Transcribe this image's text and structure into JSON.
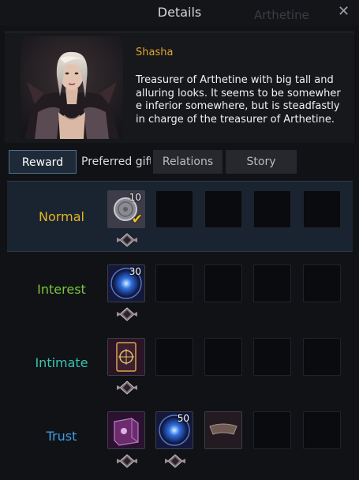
{
  "window": {
    "title": "Details",
    "ghost_title": "Arthetine",
    "close_label": "✕"
  },
  "npc": {
    "name": "Shasha",
    "description": "Treasurer of Arthetine with big tall and\nalluring looks. It seems to be somewher\ne inferior somewhere, but is steadfastly\nin charge of the treasurer of Arthetine."
  },
  "tabs": [
    {
      "label": "Reward",
      "active": true
    },
    {
      "label": "Preferred gift",
      "active": false
    },
    {
      "label": "Relations",
      "active": false
    },
    {
      "label": "Story",
      "active": false
    }
  ],
  "tiers": [
    {
      "label": "Normal",
      "color": "#e6b325",
      "rewards": [
        {
          "icon": "silver-coin-icon",
          "count": "10",
          "claimed": true
        }
      ]
    },
    {
      "label": "Interest",
      "color": "#78c83a",
      "rewards": [
        {
          "icon": "blue-orb-icon",
          "count": "30",
          "claimed": false
        }
      ]
    },
    {
      "label": "Intimate",
      "color": "#36c5b0",
      "rewards": [
        {
          "icon": "tarot-card-icon",
          "count": "",
          "claimed": false
        }
      ]
    },
    {
      "label": "Trust",
      "color": "#3a9ee6",
      "rewards": [
        {
          "icon": "purple-book-icon",
          "count": "",
          "claimed": false
        },
        {
          "icon": "blue-orb-icon",
          "count": "50",
          "claimed": false
        },
        {
          "icon": "headband-icon",
          "count": "",
          "claimed": false
        }
      ]
    }
  ]
}
